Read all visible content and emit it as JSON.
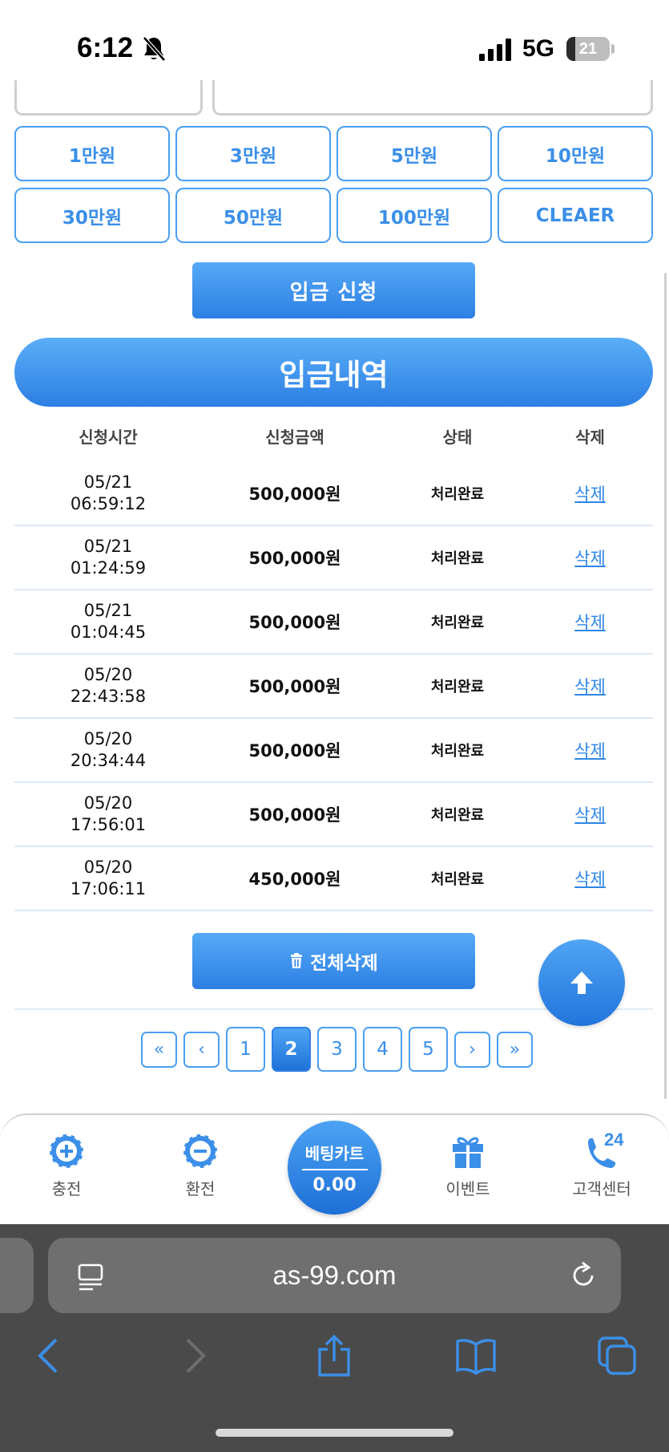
{
  "status_bar": {
    "time": "6:12",
    "network": "5G",
    "battery": "21",
    "battery_level": 0.21
  },
  "amounts": [
    "1만원",
    "3만원",
    "5만원",
    "10만원",
    "30만원",
    "50만원",
    "100만원",
    "CLEAER"
  ],
  "apply_button": "입금 신청",
  "history_title": "입금내역",
  "table": {
    "headers": [
      "신청시간",
      "신청금액",
      "상태",
      "삭제"
    ],
    "rows": [
      {
        "date": "05/21",
        "time": "06:59:12",
        "amount": "500,000원",
        "status": "처리완료",
        "action": "삭제"
      },
      {
        "date": "05/21",
        "time": "01:24:59",
        "amount": "500,000원",
        "status": "처리완료",
        "action": "삭제"
      },
      {
        "date": "05/21",
        "time": "01:04:45",
        "amount": "500,000원",
        "status": "처리완료",
        "action": "삭제"
      },
      {
        "date": "05/20",
        "time": "22:43:58",
        "amount": "500,000원",
        "status": "처리완료",
        "action": "삭제"
      },
      {
        "date": "05/20",
        "time": "20:34:44",
        "amount": "500,000원",
        "status": "처리완료",
        "action": "삭제"
      },
      {
        "date": "05/20",
        "time": "17:56:01",
        "amount": "500,000원",
        "status": "처리완료",
        "action": "삭제"
      },
      {
        "date": "05/20",
        "time": "17:06:11",
        "amount": "450,000원",
        "status": "처리완료",
        "action": "삭제"
      }
    ]
  },
  "delete_all_button": "전체삭제",
  "pagination": {
    "first": "«",
    "prev": "‹",
    "pages": [
      "1",
      "2",
      "3",
      "4",
      "5"
    ],
    "current": "2",
    "next": "›",
    "last": "»"
  },
  "bottom_nav": {
    "charge": "충전",
    "exchange": "환전",
    "bet_cart_label": "베팅카트",
    "bet_cart_value": "0.00",
    "event": "이벤트",
    "support": "고객센터",
    "support_badge": "24"
  },
  "browser": {
    "url": "as-99.com"
  },
  "colors": {
    "accent": "#2d80e3",
    "accent_light": "#55a9f7",
    "link": "#2f86e6",
    "browser_bg": "#4a4a4a",
    "toolbar_icon": "#3b8fe8"
  },
  "icons": {
    "status": [
      "bell-slash-icon",
      "signal-icon"
    ],
    "nav": [
      "plus-chip-icon",
      "minus-chip-icon",
      "gift-icon",
      "phone-icon"
    ],
    "browser": [
      "reader-icon",
      "reload-icon",
      "back-icon",
      "forward-icon",
      "share-icon",
      "bookmarks-icon",
      "tabs-icon"
    ]
  }
}
